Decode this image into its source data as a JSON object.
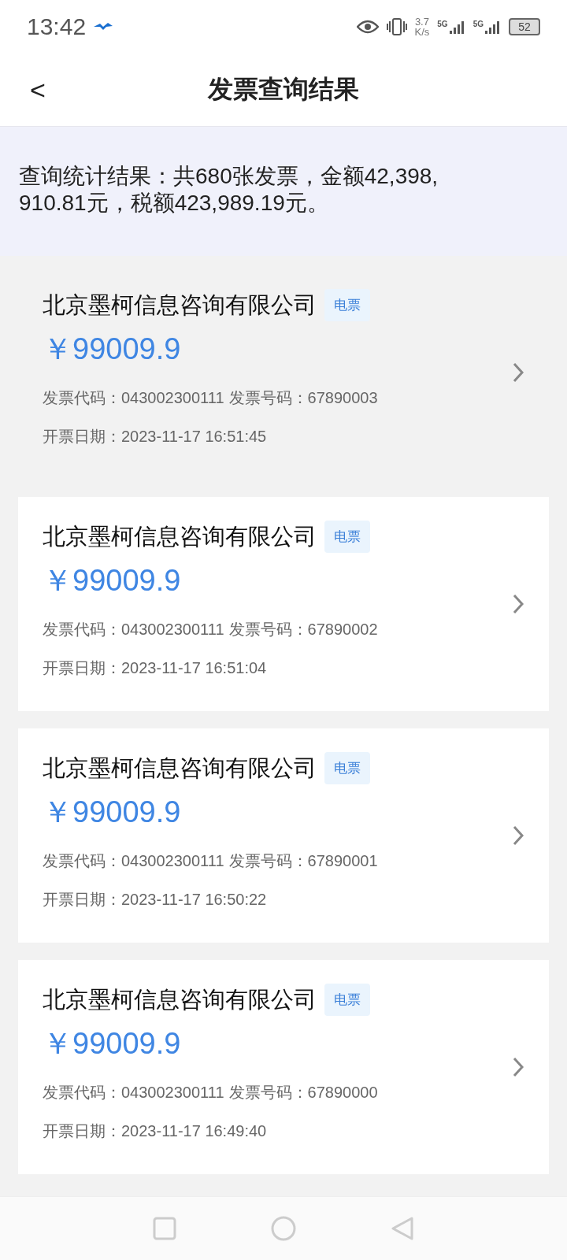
{
  "status_bar": {
    "time": "13:42",
    "speed_value": "3.7",
    "speed_unit": "K/s",
    "networks": [
      "5G",
      "5G"
    ],
    "battery": "52"
  },
  "header": {
    "back": "<",
    "title": "发票查询结果"
  },
  "summary": {
    "text": "查询统计结果：共680张发票，金额42,398,910.81元，税额423,989.19元。"
  },
  "invoices": [
    {
      "company": "北京墨柯信息咨询有限公司",
      "tag": "电票",
      "amount": "￥99009.9",
      "code_label": "发票代码：",
      "code": "043002300111",
      "number_label": "发票号码：",
      "number": "67890003",
      "date_label": "开票日期：",
      "date": "2023-11-17 16:51:45",
      "selected": true
    },
    {
      "company": "北京墨柯信息咨询有限公司",
      "tag": "电票",
      "amount": "￥99009.9",
      "code_label": "发票代码：",
      "code": "043002300111",
      "number_label": "发票号码：",
      "number": "67890002",
      "date_label": "开票日期：",
      "date": "2023-11-17 16:51:04",
      "selected": false
    },
    {
      "company": "北京墨柯信息咨询有限公司",
      "tag": "电票",
      "amount": "￥99009.9",
      "code_label": "发票代码：",
      "code": "043002300111",
      "number_label": "发票号码：",
      "number": "67890001",
      "date_label": "开票日期：",
      "date": "2023-11-17 16:50:22",
      "selected": false
    },
    {
      "company": "北京墨柯信息咨询有限公司",
      "tag": "电票",
      "amount": "￥99009.9",
      "code_label": "发票代码：",
      "code": "043002300111",
      "number_label": "发票号码：",
      "number": "67890000",
      "date_label": "开票日期：",
      "date": "2023-11-17 16:49:40",
      "selected": false
    }
  ]
}
